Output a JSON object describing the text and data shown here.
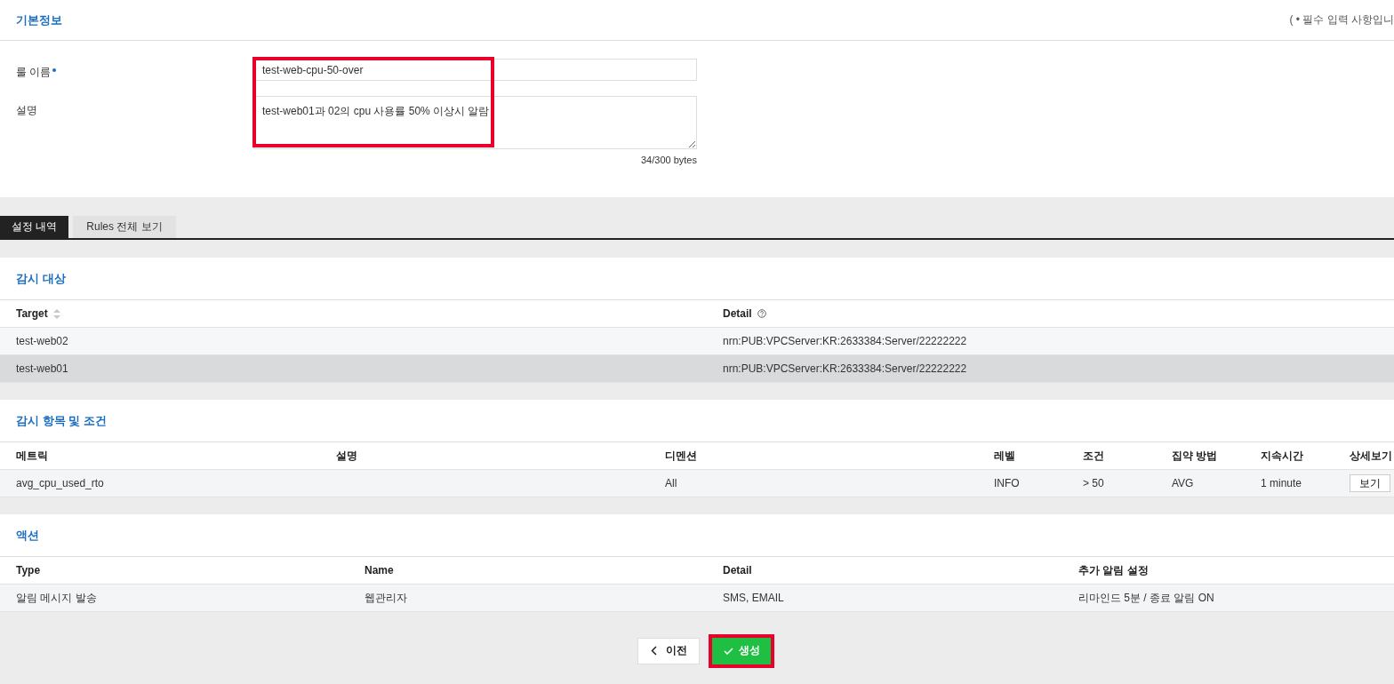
{
  "basic_info": {
    "title": "기본정보",
    "required_note": "( • 필수 입력 사항입니",
    "highlighted": true,
    "fields": [
      {
        "kind": "input",
        "label": "룰 이름",
        "required": true,
        "value": "test-web-cpu-50-over"
      },
      {
        "kind": "textarea",
        "label": "설명",
        "required": false,
        "value": "test-web01과 02의 cpu 사용률 50% 이상시 알람",
        "counter": "34/300 bytes"
      }
    ]
  },
  "tabs": [
    {
      "label": "설정 내역",
      "selected": true
    },
    {
      "label": "Rules 전체 보기",
      "selected": false
    }
  ],
  "targets": {
    "title": "감시 대상",
    "columns": [
      {
        "label": "Target",
        "sortable": true,
        "help": false
      },
      {
        "label": "Detail",
        "sortable": false,
        "help": true
      }
    ],
    "rows": [
      {
        "cells": [
          "test-web02",
          "nrn:PUB:VPCServer:KR:2633384:Server/22222222"
        ],
        "selected": false
      },
      {
        "cells": [
          "test-web01",
          "nrn:PUB:VPCServer:KR:2633384:Server/22222222"
        ],
        "selected": true
      }
    ]
  },
  "metrics": {
    "title": "감시 항목 및 조건",
    "columns": [
      "메트릭",
      "설명",
      "디멘션",
      "레벨",
      "조건",
      "집약 방법",
      "지속시간",
      "상세보기"
    ],
    "rows": [
      {
        "cells": [
          "avg_cpu_used_rto",
          "",
          "All",
          "INFO",
          "> 50",
          "AVG",
          "1 minute"
        ],
        "detail_button": "보기"
      }
    ]
  },
  "actions": {
    "title": "액션",
    "columns": [
      "Type",
      "Name",
      "Detail",
      "추가 알림 설정"
    ],
    "rows": [
      {
        "cells": [
          "알림 메시지 발송",
          "웹관리자",
          "SMS, EMAIL",
          "리마인드 5분 / 종료 알림 ON"
        ]
      }
    ]
  },
  "footer": {
    "back_button": "이전",
    "create_button": {
      "label": "생성",
      "highlighted": true
    }
  }
}
